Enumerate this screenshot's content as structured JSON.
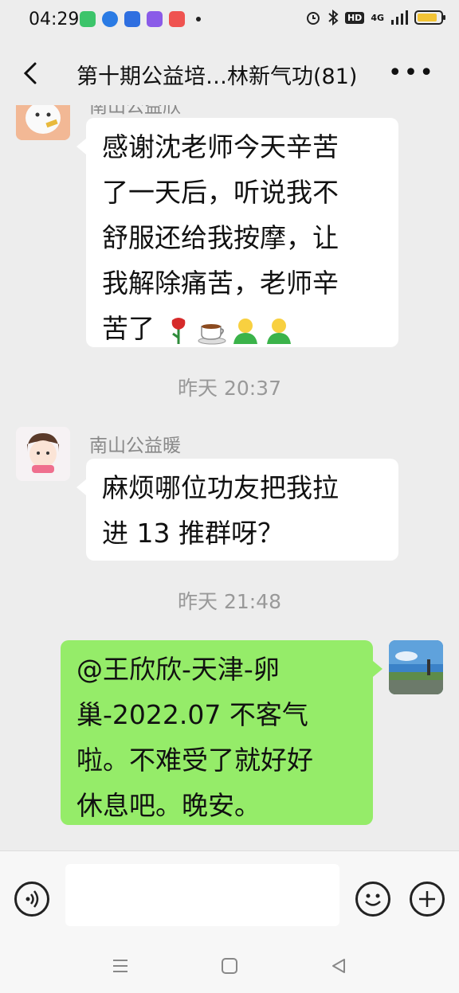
{
  "status_bar": {
    "time": "04:29",
    "network": "4G",
    "hd_label": "HD"
  },
  "header": {
    "title": "第十期公益培…林新气功(81)"
  },
  "messages": [
    {
      "sender": "南山公益欣",
      "line1": "感谢沈老师今天辛苦",
      "line2": "了一天后，听说我不",
      "line3": "舒服还给我按摩，让",
      "line4": "我解除痛苦，老师辛",
      "line5": "苦了"
    },
    {
      "sender": "南山公益暖",
      "line1": "麻烦哪位功友把我拉",
      "line2": "进 13 推群呀？"
    },
    {
      "line1": "@王欣欣-天津-卵",
      "line2": "巢-2022.07  不客气",
      "line3": "啦。不难受了就好好",
      "line4": "休息吧。晚安。"
    }
  ],
  "timestamps": [
    "昨天 20:37",
    "昨天 21:48"
  ],
  "emojis": [
    "rose-icon",
    "coffee-icon",
    "person-icon",
    "person-icon"
  ],
  "colors": {
    "self_bubble": "#95ec69",
    "other_bubble": "#ffffff",
    "background": "#ededed"
  },
  "input_bar": {
    "voice_icon": "voice-icon",
    "emoji_icon": "smile-icon",
    "add_icon": "plus-icon"
  }
}
